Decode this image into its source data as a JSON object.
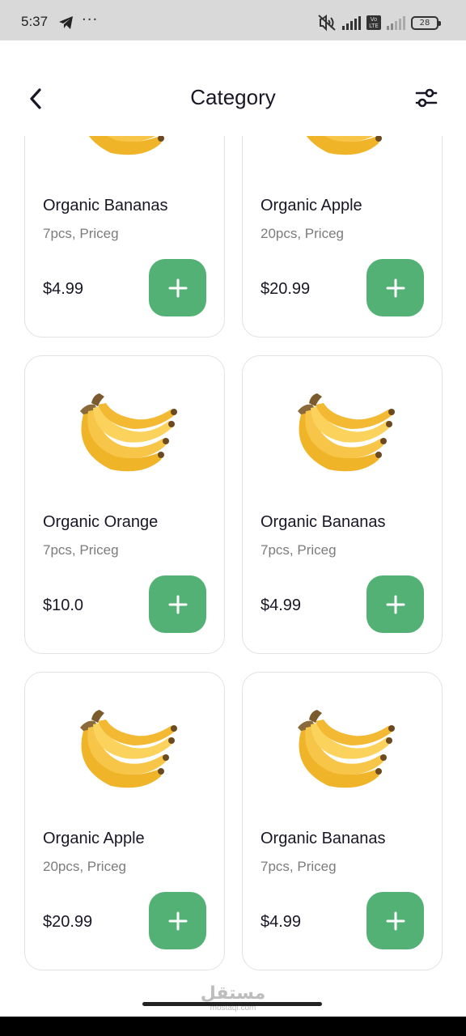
{
  "status_bar": {
    "time": "5:37",
    "dots": "···",
    "volte": "Vo LTE",
    "battery": "28"
  },
  "header": {
    "title": "Category",
    "back_icon": "chevron-left-icon",
    "filter_icon": "sliders-icon"
  },
  "theme": {
    "accent": "#53b175",
    "text": "#181725",
    "muted": "#7c7c7c",
    "border": "#e2e2e2"
  },
  "products": [
    {
      "name": "Organic Bananas",
      "qty": "7pcs, Priceg",
      "price": "$4.99"
    },
    {
      "name": "Organic Apple",
      "qty": "20pcs, Priceg",
      "price": "$20.99"
    },
    {
      "name": "Organic Orange",
      "qty": "7pcs, Priceg",
      "price": "$10.0"
    },
    {
      "name": "Organic Bananas",
      "qty": "7pcs, Priceg",
      "price": "$4.99"
    },
    {
      "name": "Organic Apple",
      "qty": "20pcs, Priceg",
      "price": "$20.99"
    },
    {
      "name": "Organic Bananas",
      "qty": "7pcs, Priceg",
      "price": "$4.99"
    }
  ],
  "watermark": {
    "arabic": "مستقل",
    "latin": "mostaql.com"
  }
}
